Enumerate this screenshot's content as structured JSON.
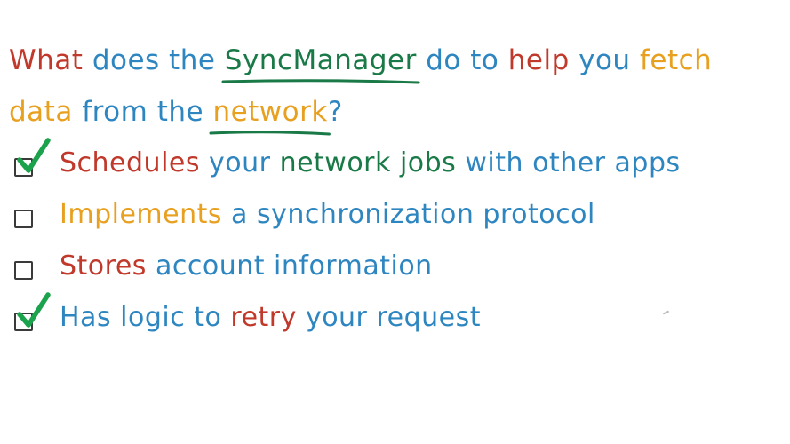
{
  "colors": {
    "red": "#c0392b",
    "blue": "#2e86c1",
    "green": "#1a7a47",
    "orange": "#e8a020",
    "check": "#1ba24c"
  },
  "question": {
    "line1": [
      {
        "text": "What",
        "color": "red"
      },
      {
        "text": "does",
        "color": "blue"
      },
      {
        "text": "the",
        "color": "blue"
      },
      {
        "text": "SyncManager",
        "color": "green",
        "underline": true
      },
      {
        "text": "do",
        "color": "blue"
      },
      {
        "text": "to",
        "color": "blue"
      },
      {
        "text": "help",
        "color": "red"
      },
      {
        "text": "you",
        "color": "blue"
      },
      {
        "text": "fetch",
        "color": "orange"
      }
    ],
    "line2": [
      {
        "text": "data",
        "color": "orange"
      },
      {
        "text": "from",
        "color": "blue"
      },
      {
        "text": "the",
        "color": "blue"
      },
      {
        "text": "network",
        "color": "orange",
        "underline": true
      },
      {
        "text": "?",
        "color": "blue",
        "attach": true
      }
    ]
  },
  "options": [
    {
      "checked": true,
      "words": [
        {
          "text": "Schedules",
          "color": "red"
        },
        {
          "text": "your",
          "color": "blue"
        },
        {
          "text": "network",
          "color": "green"
        },
        {
          "text": "jobs",
          "color": "green"
        },
        {
          "text": "with",
          "color": "blue"
        },
        {
          "text": "other",
          "color": "blue"
        },
        {
          "text": "apps",
          "color": "blue"
        }
      ]
    },
    {
      "checked": false,
      "words": [
        {
          "text": "Implements",
          "color": "orange"
        },
        {
          "text": "a",
          "color": "blue"
        },
        {
          "text": "synchronization",
          "color": "blue"
        },
        {
          "text": "protocol",
          "color": "blue"
        }
      ]
    },
    {
      "checked": false,
      "words": [
        {
          "text": "Stores",
          "color": "red"
        },
        {
          "text": "account",
          "color": "blue"
        },
        {
          "text": "information",
          "color": "blue"
        }
      ]
    },
    {
      "checked": true,
      "words": [
        {
          "text": "Has",
          "color": "blue"
        },
        {
          "text": "logic",
          "color": "blue"
        },
        {
          "text": "to",
          "color": "blue"
        },
        {
          "text": "retry",
          "color": "red"
        },
        {
          "text": "your",
          "color": "blue"
        },
        {
          "text": "request",
          "color": "blue"
        }
      ]
    }
  ]
}
